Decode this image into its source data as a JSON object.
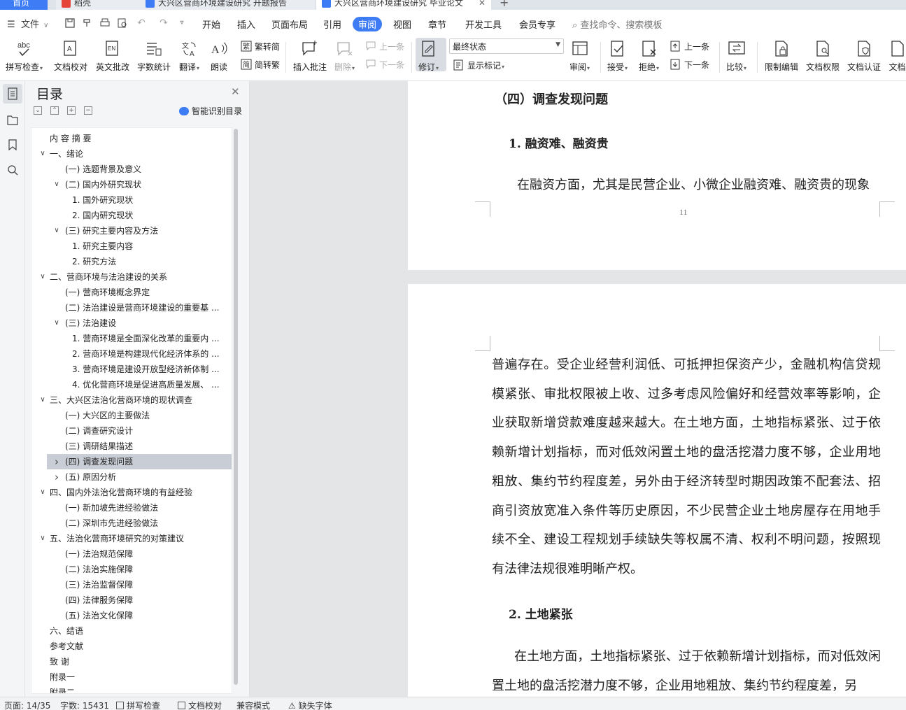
{
  "tabs": [
    {
      "label": "首页"
    },
    {
      "label": "稻壳"
    },
    {
      "label": "大兴区营商环境建设研究 开题报告"
    },
    {
      "label": "大兴区营商环境建设研究 毕业论文"
    }
  ],
  "menu": {
    "file": "文件",
    "items": [
      "开始",
      "插入",
      "页面布局",
      "引用",
      "审阅",
      "视图",
      "章节",
      "开发工具",
      "会员专享"
    ],
    "active": "审阅",
    "search": "查找命令、搜索模板"
  },
  "ribbon": {
    "spell_check": "拼写检查",
    "doc_proof": "文档校对",
    "en_review": "英文批改",
    "word_count": "字数统计",
    "translate": "翻译",
    "read_aloud": "朗读",
    "to_traditional": "繁转简",
    "to_simplified": "简转繁",
    "insert_comment": "插入批注",
    "delete": "删除",
    "prev": "上一条",
    "next": "下一条",
    "revise": "修订",
    "final_state": "最终状态",
    "show_marks": "显示标记",
    "review": "审阅",
    "accept": "接受",
    "reject": "拒绝",
    "prev2": "上一条",
    "next2": "下一条",
    "compare": "比较",
    "restrict_edit": "限制编辑",
    "doc_permission": "文档权限",
    "doc_auth": "文档认证",
    "doc_cut": "文档"
  },
  "toc": {
    "title": "目录",
    "smart": "智能识别目录",
    "items": [
      {
        "label": "内 容 摘  要",
        "level": 0,
        "arrow": ""
      },
      {
        "label": "一、绪论",
        "level": 0,
        "arrow": "down"
      },
      {
        "label": "(一) 选题背景及意义",
        "level": 1,
        "arrow": ""
      },
      {
        "label": "(二) 国内外研究现状",
        "level": 1,
        "arrow": "down"
      },
      {
        "label": "1. 国外研究现状",
        "level": 2,
        "arrow": ""
      },
      {
        "label": "2. 国内研究现状",
        "level": 2,
        "arrow": ""
      },
      {
        "label": "(三) 研究主要内容及方法",
        "level": 1,
        "arrow": "down"
      },
      {
        "label": "1. 研究主要内容",
        "level": 2,
        "arrow": ""
      },
      {
        "label": "2. 研究方法",
        "level": 2,
        "arrow": ""
      },
      {
        "label": "二、营商环境与法治建设的关系",
        "level": 0,
        "arrow": "down"
      },
      {
        "label": "(一) 营商环境概念界定",
        "level": 1,
        "arrow": ""
      },
      {
        "label": "(二) 法治建设是营商环境建设的重要基 ...",
        "level": 1,
        "arrow": ""
      },
      {
        "label": "(三) 法治建设",
        "level": 1,
        "arrow": "down"
      },
      {
        "label": "1. 营商环境是全面深化改革的重要内 ...",
        "level": 2,
        "arrow": ""
      },
      {
        "label": "2. 营商环境是构建现代化经济体系的 ...",
        "level": 2,
        "arrow": ""
      },
      {
        "label": "3. 营商环境是建设开放型经济新体制 ...",
        "level": 2,
        "arrow": ""
      },
      {
        "label": "4. 优化营商环境是促进高质量发展、 ...",
        "level": 2,
        "arrow": ""
      },
      {
        "label": "三、大兴区法治化营商环境的现状调查",
        "level": 0,
        "arrow": "down"
      },
      {
        "label": "(一) 大兴区的主要做法",
        "level": 1,
        "arrow": ""
      },
      {
        "label": "(二) 调查研究设计",
        "level": 1,
        "arrow": ""
      },
      {
        "label": "(三) 调研结果描述",
        "level": 1,
        "arrow": ""
      },
      {
        "label": "(四) 调查发现问题",
        "level": 1,
        "arrow": "right",
        "selected": true
      },
      {
        "label": "(五) 原因分析",
        "level": 1,
        "arrow": "right"
      },
      {
        "label": "四、国内外法治化营商环境的有益经验",
        "level": 0,
        "arrow": "down"
      },
      {
        "label": "(一) 新加坡先进经验做法",
        "level": 1,
        "arrow": ""
      },
      {
        "label": "(二) 深圳市先进经验做法",
        "level": 1,
        "arrow": ""
      },
      {
        "label": "五、法治化营商环境研究的对策建议",
        "level": 0,
        "arrow": "down"
      },
      {
        "label": "(一) 法治规范保障",
        "level": 1,
        "arrow": ""
      },
      {
        "label": "(二) 法治实施保障",
        "level": 1,
        "arrow": ""
      },
      {
        "label": "(三) 法治监督保障",
        "level": 1,
        "arrow": ""
      },
      {
        "label": "(四) 法律服务保障",
        "level": 1,
        "arrow": ""
      },
      {
        "label": "(五) 法治文化保障",
        "level": 1,
        "arrow": ""
      },
      {
        "label": "六、结语",
        "level": 0,
        "arrow": ""
      },
      {
        "label": "参考文献",
        "level": 0,
        "arrow": ""
      },
      {
        "label": "致  谢",
        "level": 0,
        "arrow": ""
      },
      {
        "label": "附录一",
        "level": 0,
        "arrow": ""
      },
      {
        "label": "附录二",
        "level": 0,
        "arrow": ""
      }
    ]
  },
  "doc": {
    "page1": {
      "heading": "（四）调查发现问题",
      "subheading": "1. 融资难、融资贵",
      "para": "在融资方面，尤其是民营企业、小微企业融资难、融资贵的现象",
      "page_number": "11"
    },
    "page2": {
      "para1": "普遍存在。受企业经营利润低、可抵押担保资产少，金融机构信贷规模紧张、审批权限被上收、过多考虑风险偏好和经营效率等影响，企业获取新增贷款难度越来越大。在土地方面，土地指标紧张、过于依赖新增计划指标，而对低效闲置土地的盘活挖潜力度不够，企业用地粗放、集约节约程度差，另外由于经济转型时期因政策不配套法、招商引资放宽准入条件等历史原因，不少民营企业土地房屋存在用地手续不全、建设工程规划手续缺失等权属不清、权利不明问题，按照现有法律法规很难明晰产权。",
      "subheading": "2. 土地紧张",
      "para2": "在土地方面，土地指标紧张、过于依赖新增计划指标，而对低效闲置土地的盘活挖潜力度不够，企业用地粗放、集约节约程度差，另"
    }
  },
  "status": {
    "page": "页面: 14/35",
    "words": "字数: 15431",
    "spell": "拼写检查",
    "proof": "文档校对",
    "compat": "兼容模式",
    "missing_font": "缺失字体"
  },
  "colors": {
    "accent": "#3d7cf5",
    "selected_row": "#c9ced6"
  }
}
